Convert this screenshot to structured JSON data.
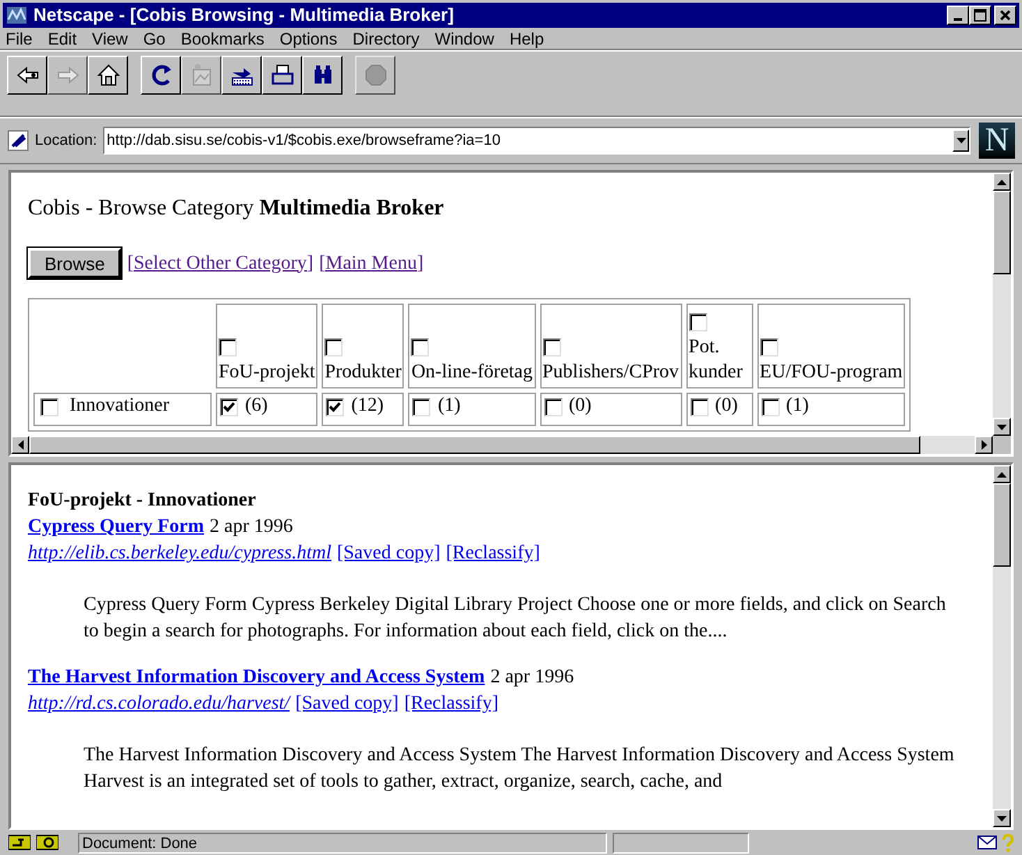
{
  "window": {
    "title": "Netscape - [Cobis Browsing - Multimedia Broker]"
  },
  "menu": [
    "File",
    "Edit",
    "View",
    "Go",
    "Bookmarks",
    "Options",
    "Directory",
    "Window",
    "Help"
  ],
  "toolbar": [
    {
      "kind": "back",
      "disabled": false
    },
    {
      "kind": "forward",
      "disabled": true
    },
    {
      "kind": "home",
      "disabled": false
    },
    {
      "kind": "reload",
      "disabled": false
    },
    {
      "kind": "images",
      "disabled": true
    },
    {
      "kind": "open",
      "disabled": false
    },
    {
      "kind": "print",
      "disabled": false
    },
    {
      "kind": "find",
      "disabled": false
    },
    {
      "kind": "stop",
      "disabled": true
    }
  ],
  "location": {
    "label": "Location:",
    "value": "http://dab.sisu.se/cobis-v1/$cobis.exe/browseframe?ia=10",
    "logo": "N"
  },
  "top_frame": {
    "heading": "Cobis - Browse Category **Multimedia Broker**",
    "button": "Browse",
    "links": [
      "[Select Other Category]",
      "[Main Menu]"
    ],
    "columns": [
      {
        "label": "FoU-projekt",
        "checked": false
      },
      {
        "label": "Produkter",
        "checked": false
      },
      {
        "label": "On-line-företag",
        "checked": false
      },
      {
        "label": "Publishers/CProv",
        "checked": false
      },
      {
        "label": "Pot. kunder",
        "checked": false
      },
      {
        "label": "EU/FOU-program",
        "checked": false
      }
    ],
    "rows": [
      {
        "label": "Innovationer",
        "checked": false,
        "cells": [
          {
            "count": "(6)",
            "checked": true
          },
          {
            "count": "(12)",
            "checked": true
          },
          {
            "count": "(1)",
            "checked": false
          },
          {
            "count": "(0)",
            "checked": false
          },
          {
            "count": "(0)",
            "checked": false
          },
          {
            "count": "(1)",
            "checked": false
          }
        ]
      }
    ]
  },
  "bottom_frame": {
    "heading": "FoU-projekt - Innovationer",
    "results": [
      {
        "title": "Cypress Query Form",
        "date": "2 apr 1996",
        "url": "http://elib.cs.berkeley.edu/cypress.html",
        "links": [
          "[Saved copy]",
          "[Reclassify]"
        ],
        "summary": "Cypress Query Form Cypress Berkeley Digital Library Project Choose one or more fields, and click on Search to begin a search for photographs. For information about each field, click on the...."
      },
      {
        "title": "The Harvest Information Discovery and Access System",
        "date": "2 apr 1996",
        "url": "http://rd.cs.colorado.edu/harvest/",
        "links": [
          "[Saved copy]",
          "[Reclassify]"
        ],
        "summary": "The Harvest Information Discovery and Access System The Harvest Information Discovery and Access System Harvest is an integrated set of tools to gather, extract, organize, search, cache, and"
      }
    ]
  },
  "status_bar": {
    "text": "Document: Done"
  }
}
